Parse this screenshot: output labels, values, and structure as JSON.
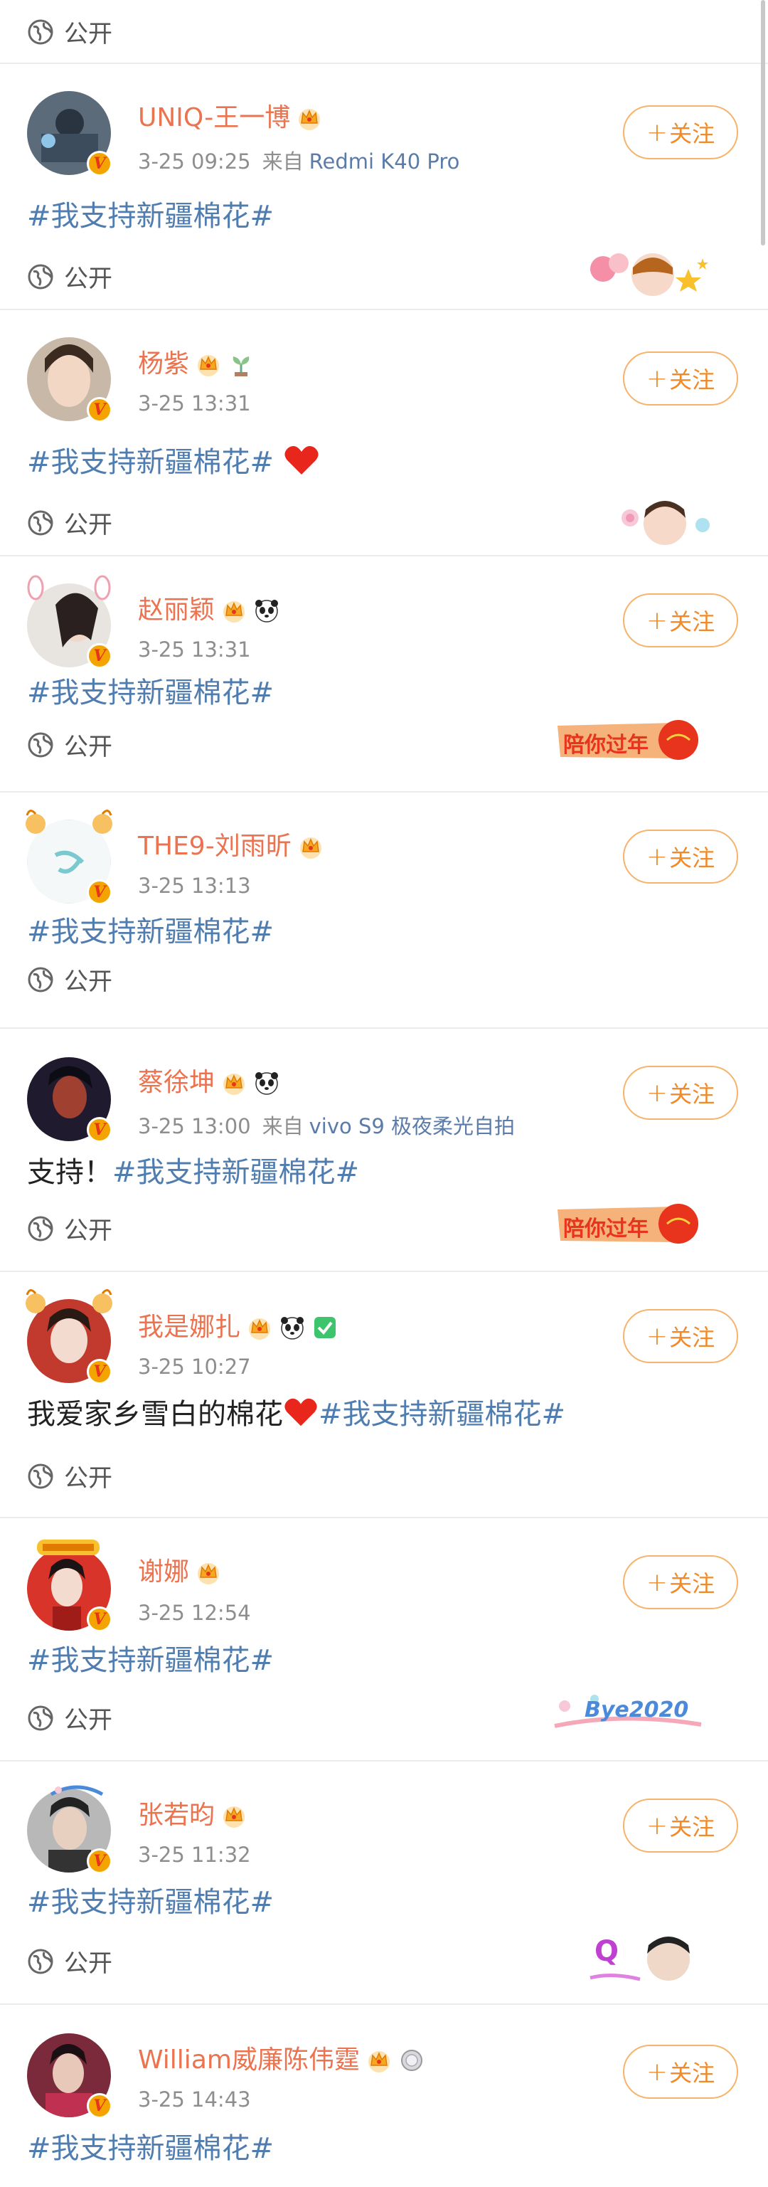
{
  "top_visibility": "公开",
  "follow_label": "关注",
  "visibility_label": "公开",
  "posts": [
    {
      "name": "UNIQ-王一博",
      "time": "3-25 09:25",
      "source_prefix": "来自",
      "source": "Redmi K40 Pro",
      "tag": "#我支持新疆棉花#",
      "sticker": "balloons-girl"
    },
    {
      "name": "杨紫",
      "time": "3-25 13:31",
      "source_prefix": "",
      "source": "",
      "tag": "#我支持新疆棉花#",
      "sticker": "girl-candy"
    },
    {
      "name": "赵丽颖",
      "time": "3-25 13:31",
      "source_prefix": "",
      "source": "",
      "tag": "#我支持新疆棉花#",
      "sticker": "new-year",
      "sticker_text": "陪你过年"
    },
    {
      "name": "THE9-刘雨昕",
      "time": "3-25 13:13",
      "source_prefix": "",
      "source": "",
      "tag": "#我支持新疆棉花#",
      "sticker": ""
    },
    {
      "name": "蔡徐坤",
      "time": "3-25 13:00",
      "source_prefix": "来自",
      "source": "vivo S9 极夜柔光自拍",
      "prefix": "支持！",
      "tag": "#我支持新疆棉花#",
      "sticker": "new-year",
      "sticker_text": "陪你过年"
    },
    {
      "name": "我是娜扎",
      "time": "3-25 10:27",
      "source_prefix": "",
      "source": "",
      "prefix": "我爱家乡雪白的棉花",
      "tag": "#我支持新疆棉花#",
      "sticker": ""
    },
    {
      "name": "谢娜",
      "time": "3-25 12:54",
      "source_prefix": "",
      "source": "",
      "tag": "#我支持新疆棉花#",
      "sticker": "bye2020",
      "sticker_text": "Bye2020"
    },
    {
      "name": "张若昀",
      "time": "3-25 11:32",
      "source_prefix": "",
      "source": "",
      "tag": "#我支持新疆棉花#",
      "sticker": "q-man",
      "sticker_text": "Q"
    },
    {
      "name": "William威廉陈伟霆",
      "time": "3-25 14:43",
      "source_prefix": "",
      "source": "",
      "tag": "#我支持新疆棉花#",
      "sticker": ""
    }
  ],
  "colors": {
    "name": "#eb7350",
    "tag": "#507daf",
    "follow": "#f08a2a",
    "meta": "#8e8e8e",
    "source": "#5b7ba8"
  }
}
